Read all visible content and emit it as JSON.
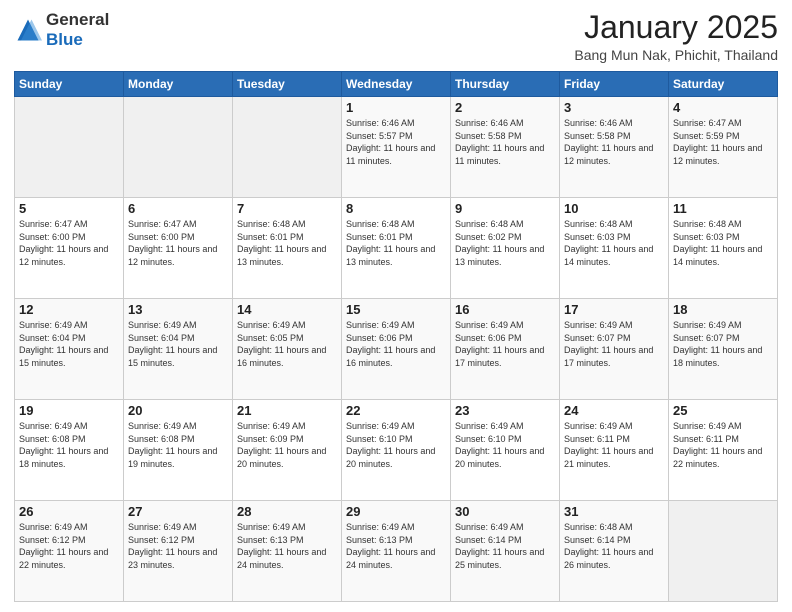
{
  "logo": {
    "line1": "General",
    "line2": "Blue"
  },
  "header": {
    "month": "January 2025",
    "location": "Bang Mun Nak, Phichit, Thailand"
  },
  "weekdays": [
    "Sunday",
    "Monday",
    "Tuesday",
    "Wednesday",
    "Thursday",
    "Friday",
    "Saturday"
  ],
  "weeks": [
    [
      {
        "day": "",
        "sunrise": "",
        "sunset": "",
        "daylight": ""
      },
      {
        "day": "",
        "sunrise": "",
        "sunset": "",
        "daylight": ""
      },
      {
        "day": "",
        "sunrise": "",
        "sunset": "",
        "daylight": ""
      },
      {
        "day": "1",
        "sunrise": "Sunrise: 6:46 AM",
        "sunset": "Sunset: 5:57 PM",
        "daylight": "Daylight: 11 hours and 11 minutes."
      },
      {
        "day": "2",
        "sunrise": "Sunrise: 6:46 AM",
        "sunset": "Sunset: 5:58 PM",
        "daylight": "Daylight: 11 hours and 11 minutes."
      },
      {
        "day": "3",
        "sunrise": "Sunrise: 6:46 AM",
        "sunset": "Sunset: 5:58 PM",
        "daylight": "Daylight: 11 hours and 12 minutes."
      },
      {
        "day": "4",
        "sunrise": "Sunrise: 6:47 AM",
        "sunset": "Sunset: 5:59 PM",
        "daylight": "Daylight: 11 hours and 12 minutes."
      }
    ],
    [
      {
        "day": "5",
        "sunrise": "Sunrise: 6:47 AM",
        "sunset": "Sunset: 6:00 PM",
        "daylight": "Daylight: 11 hours and 12 minutes."
      },
      {
        "day": "6",
        "sunrise": "Sunrise: 6:47 AM",
        "sunset": "Sunset: 6:00 PM",
        "daylight": "Daylight: 11 hours and 12 minutes."
      },
      {
        "day": "7",
        "sunrise": "Sunrise: 6:48 AM",
        "sunset": "Sunset: 6:01 PM",
        "daylight": "Daylight: 11 hours and 13 minutes."
      },
      {
        "day": "8",
        "sunrise": "Sunrise: 6:48 AM",
        "sunset": "Sunset: 6:01 PM",
        "daylight": "Daylight: 11 hours and 13 minutes."
      },
      {
        "day": "9",
        "sunrise": "Sunrise: 6:48 AM",
        "sunset": "Sunset: 6:02 PM",
        "daylight": "Daylight: 11 hours and 13 minutes."
      },
      {
        "day": "10",
        "sunrise": "Sunrise: 6:48 AM",
        "sunset": "Sunset: 6:03 PM",
        "daylight": "Daylight: 11 hours and 14 minutes."
      },
      {
        "day": "11",
        "sunrise": "Sunrise: 6:48 AM",
        "sunset": "Sunset: 6:03 PM",
        "daylight": "Daylight: 11 hours and 14 minutes."
      }
    ],
    [
      {
        "day": "12",
        "sunrise": "Sunrise: 6:49 AM",
        "sunset": "Sunset: 6:04 PM",
        "daylight": "Daylight: 11 hours and 15 minutes."
      },
      {
        "day": "13",
        "sunrise": "Sunrise: 6:49 AM",
        "sunset": "Sunset: 6:04 PM",
        "daylight": "Daylight: 11 hours and 15 minutes."
      },
      {
        "day": "14",
        "sunrise": "Sunrise: 6:49 AM",
        "sunset": "Sunset: 6:05 PM",
        "daylight": "Daylight: 11 hours and 16 minutes."
      },
      {
        "day": "15",
        "sunrise": "Sunrise: 6:49 AM",
        "sunset": "Sunset: 6:06 PM",
        "daylight": "Daylight: 11 hours and 16 minutes."
      },
      {
        "day": "16",
        "sunrise": "Sunrise: 6:49 AM",
        "sunset": "Sunset: 6:06 PM",
        "daylight": "Daylight: 11 hours and 17 minutes."
      },
      {
        "day": "17",
        "sunrise": "Sunrise: 6:49 AM",
        "sunset": "Sunset: 6:07 PM",
        "daylight": "Daylight: 11 hours and 17 minutes."
      },
      {
        "day": "18",
        "sunrise": "Sunrise: 6:49 AM",
        "sunset": "Sunset: 6:07 PM",
        "daylight": "Daylight: 11 hours and 18 minutes."
      }
    ],
    [
      {
        "day": "19",
        "sunrise": "Sunrise: 6:49 AM",
        "sunset": "Sunset: 6:08 PM",
        "daylight": "Daylight: 11 hours and 18 minutes."
      },
      {
        "day": "20",
        "sunrise": "Sunrise: 6:49 AM",
        "sunset": "Sunset: 6:08 PM",
        "daylight": "Daylight: 11 hours and 19 minutes."
      },
      {
        "day": "21",
        "sunrise": "Sunrise: 6:49 AM",
        "sunset": "Sunset: 6:09 PM",
        "daylight": "Daylight: 11 hours and 20 minutes."
      },
      {
        "day": "22",
        "sunrise": "Sunrise: 6:49 AM",
        "sunset": "Sunset: 6:10 PM",
        "daylight": "Daylight: 11 hours and 20 minutes."
      },
      {
        "day": "23",
        "sunrise": "Sunrise: 6:49 AM",
        "sunset": "Sunset: 6:10 PM",
        "daylight": "Daylight: 11 hours and 20 minutes."
      },
      {
        "day": "24",
        "sunrise": "Sunrise: 6:49 AM",
        "sunset": "Sunset: 6:11 PM",
        "daylight": "Daylight: 11 hours and 21 minutes."
      },
      {
        "day": "25",
        "sunrise": "Sunrise: 6:49 AM",
        "sunset": "Sunset: 6:11 PM",
        "daylight": "Daylight: 11 hours and 22 minutes."
      }
    ],
    [
      {
        "day": "26",
        "sunrise": "Sunrise: 6:49 AM",
        "sunset": "Sunset: 6:12 PM",
        "daylight": "Daylight: 11 hours and 22 minutes."
      },
      {
        "day": "27",
        "sunrise": "Sunrise: 6:49 AM",
        "sunset": "Sunset: 6:12 PM",
        "daylight": "Daylight: 11 hours and 23 minutes."
      },
      {
        "day": "28",
        "sunrise": "Sunrise: 6:49 AM",
        "sunset": "Sunset: 6:13 PM",
        "daylight": "Daylight: 11 hours and 24 minutes."
      },
      {
        "day": "29",
        "sunrise": "Sunrise: 6:49 AM",
        "sunset": "Sunset: 6:13 PM",
        "daylight": "Daylight: 11 hours and 24 minutes."
      },
      {
        "day": "30",
        "sunrise": "Sunrise: 6:49 AM",
        "sunset": "Sunset: 6:14 PM",
        "daylight": "Daylight: 11 hours and 25 minutes."
      },
      {
        "day": "31",
        "sunrise": "Sunrise: 6:48 AM",
        "sunset": "Sunset: 6:14 PM",
        "daylight": "Daylight: 11 hours and 26 minutes."
      },
      {
        "day": "",
        "sunrise": "",
        "sunset": "",
        "daylight": ""
      }
    ]
  ]
}
